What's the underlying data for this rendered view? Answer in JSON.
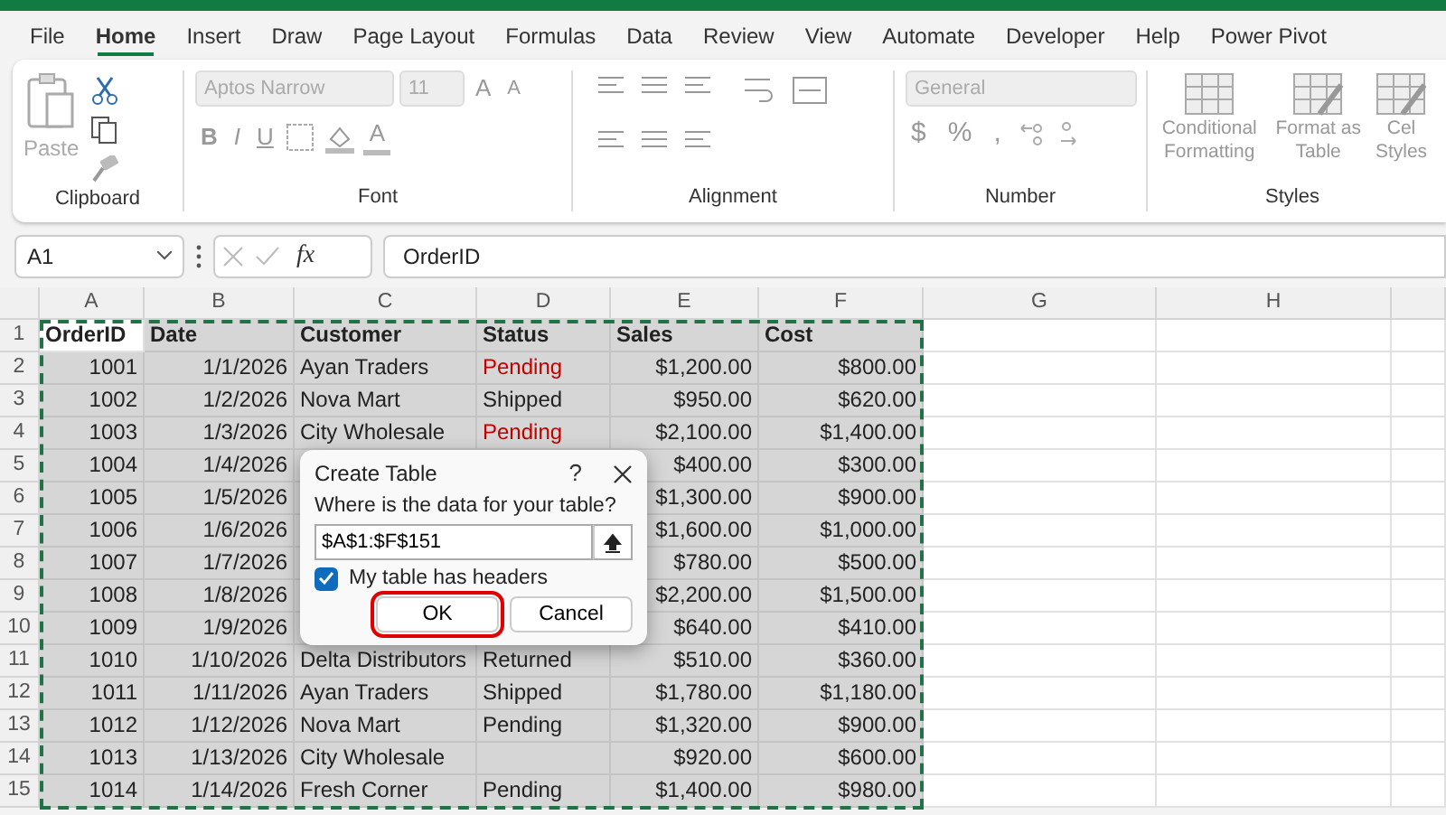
{
  "tabs": [
    {
      "label": "File",
      "selected": false
    },
    {
      "label": "Home",
      "selected": true
    },
    {
      "label": "Insert",
      "selected": false
    },
    {
      "label": "Draw",
      "selected": false
    },
    {
      "label": "Page Layout",
      "selected": false
    },
    {
      "label": "Formulas",
      "selected": false
    },
    {
      "label": "Data",
      "selected": false
    },
    {
      "label": "Review",
      "selected": false
    },
    {
      "label": "View",
      "selected": false
    },
    {
      "label": "Automate",
      "selected": false
    },
    {
      "label": "Developer",
      "selected": false
    },
    {
      "label": "Help",
      "selected": false
    },
    {
      "label": "Power Pivot",
      "selected": false
    }
  ],
  "ribbon": {
    "disabled": true,
    "clipboard": {
      "label": "Clipboard",
      "paste": "Paste"
    },
    "font": {
      "label": "Font",
      "font_name": "Aptos Narrow",
      "font_size": "11",
      "grow": "A",
      "shrink": "A",
      "style_buttons": [
        "B",
        "I",
        "U"
      ],
      "font_color": "A"
    },
    "alignment": {
      "label": "Alignment"
    },
    "number": {
      "label": "Number",
      "format": "General",
      "buttons": [
        "$",
        "%",
        ","
      ]
    },
    "styles": {
      "label": "Styles",
      "buttons": [
        "Conditional Formatting",
        "Format as Table",
        "Cel Styles"
      ]
    }
  },
  "formula_bar": {
    "name_box": "A1",
    "fx": "fx",
    "value": "OrderID"
  },
  "sheet": {
    "columns": [
      "A",
      "B",
      "C",
      "D",
      "E",
      "F",
      "G",
      "H"
    ],
    "rows": [
      {
        "n": "1",
        "header": true,
        "cells": [
          "OrderID",
          "Date",
          "Customer",
          "Status",
          "Sales",
          "Cost"
        ]
      },
      {
        "n": "2",
        "cells": [
          "1001",
          "1/1/2026",
          "Ayan Traders",
          "Pending",
          "$1,200.00",
          "$800.00"
        ],
        "alert": true
      },
      {
        "n": "3",
        "cells": [
          "1002",
          "1/2/2026",
          "Nova Mart",
          "Shipped",
          "$950.00",
          "$620.00"
        ],
        "alert": false
      },
      {
        "n": "4",
        "cells": [
          "1003",
          "1/3/2026",
          "City Wholesale",
          "Pending",
          "$2,100.00",
          "$1,400.00"
        ],
        "alert": true
      },
      {
        "n": "5",
        "cells": [
          "1004",
          "1/4/2026",
          null,
          null,
          "$400.00",
          "$300.00"
        ]
      },
      {
        "n": "6",
        "cells": [
          "1005",
          "1/5/2026",
          null,
          null,
          "$1,300.00",
          "$900.00"
        ]
      },
      {
        "n": "7",
        "cells": [
          "1006",
          "1/6/2026",
          null,
          null,
          "$1,600.00",
          "$1,000.00"
        ]
      },
      {
        "n": "8",
        "cells": [
          "1007",
          "1/7/2026",
          null,
          null,
          "$780.00",
          "$500.00"
        ]
      },
      {
        "n": "9",
        "cells": [
          "1008",
          "1/8/2026",
          null,
          null,
          "$2,200.00",
          "$1,500.00"
        ]
      },
      {
        "n": "10",
        "cells": [
          "1009",
          "1/9/2026",
          null,
          null,
          "$640.00",
          "$410.00"
        ]
      },
      {
        "n": "11",
        "cells": [
          "1010",
          "1/10/2026",
          "Delta Distributors",
          "Returned",
          "$510.00",
          "$360.00"
        ],
        "alert": false
      },
      {
        "n": "12",
        "cells": [
          "1011",
          "1/11/2026",
          "Ayan Traders",
          "Shipped",
          "$1,780.00",
          "$1,180.00"
        ],
        "alert": false
      },
      {
        "n": "13",
        "cells": [
          "1012",
          "1/12/2026",
          "Nova Mart",
          "Pending",
          "$1,320.00",
          "$900.00"
        ],
        "alert": false
      },
      {
        "n": "14",
        "cells": [
          "1013",
          "1/13/2026",
          "City Wholesale",
          null,
          "$920.00",
          "$600.00"
        ]
      },
      {
        "n": "15",
        "cells": [
          "1014",
          "1/14/2026",
          "Fresh Corner",
          "Pending",
          "$1,400.00",
          "$980.00"
        ],
        "alert": false
      }
    ]
  },
  "dialog": {
    "title": "Create Table",
    "help": "?",
    "prompt": "Where is the data for your table?",
    "range": "$A$1:$F$151",
    "headers_label": "My table has headers",
    "headers_checked": true,
    "ok": "OK",
    "ok_highlighted": true,
    "cancel": "Cancel"
  }
}
